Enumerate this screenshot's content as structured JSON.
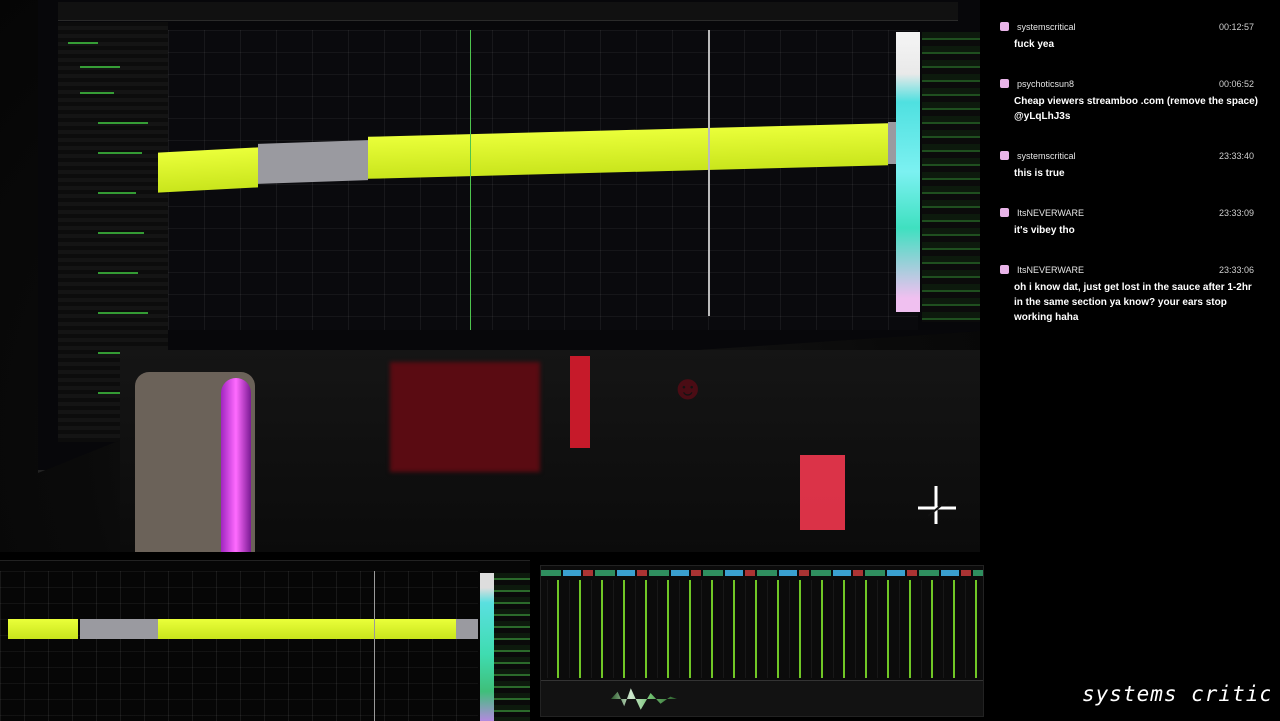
{
  "chat": {
    "messages": [
      {
        "user": "systemscritical",
        "time": "00:12:57",
        "text": "fuck yea"
      },
      {
        "user": "psychoticsun8",
        "time": "00:06:52",
        "text": "Cheap viewers streamboo .com (remove the space) @yLqLhJ3s"
      },
      {
        "user": "systemscritical",
        "time": "23:33:40",
        "text": "this is true"
      },
      {
        "user": "ItsNEVERWARE",
        "time": "23:33:09",
        "text": "it's vibey tho"
      },
      {
        "user": "ItsNEVERWARE",
        "time": "23:33:06",
        "text": "oh i know dat, just get lost in the sauce after 1-2hr in the same section ya know? your ears stop working haha"
      }
    ]
  },
  "branding": {
    "text": "systems critical"
  },
  "icons": {
    "badge": "subscriber-badge-icon",
    "cursor": "crosshair-cursor-icon"
  },
  "colors": {
    "clip_yellow": "#e4ff2c",
    "clip_gray": "#9a9aa0",
    "badge": "#e8b4e8",
    "meter_green": "#7cdc2a"
  }
}
